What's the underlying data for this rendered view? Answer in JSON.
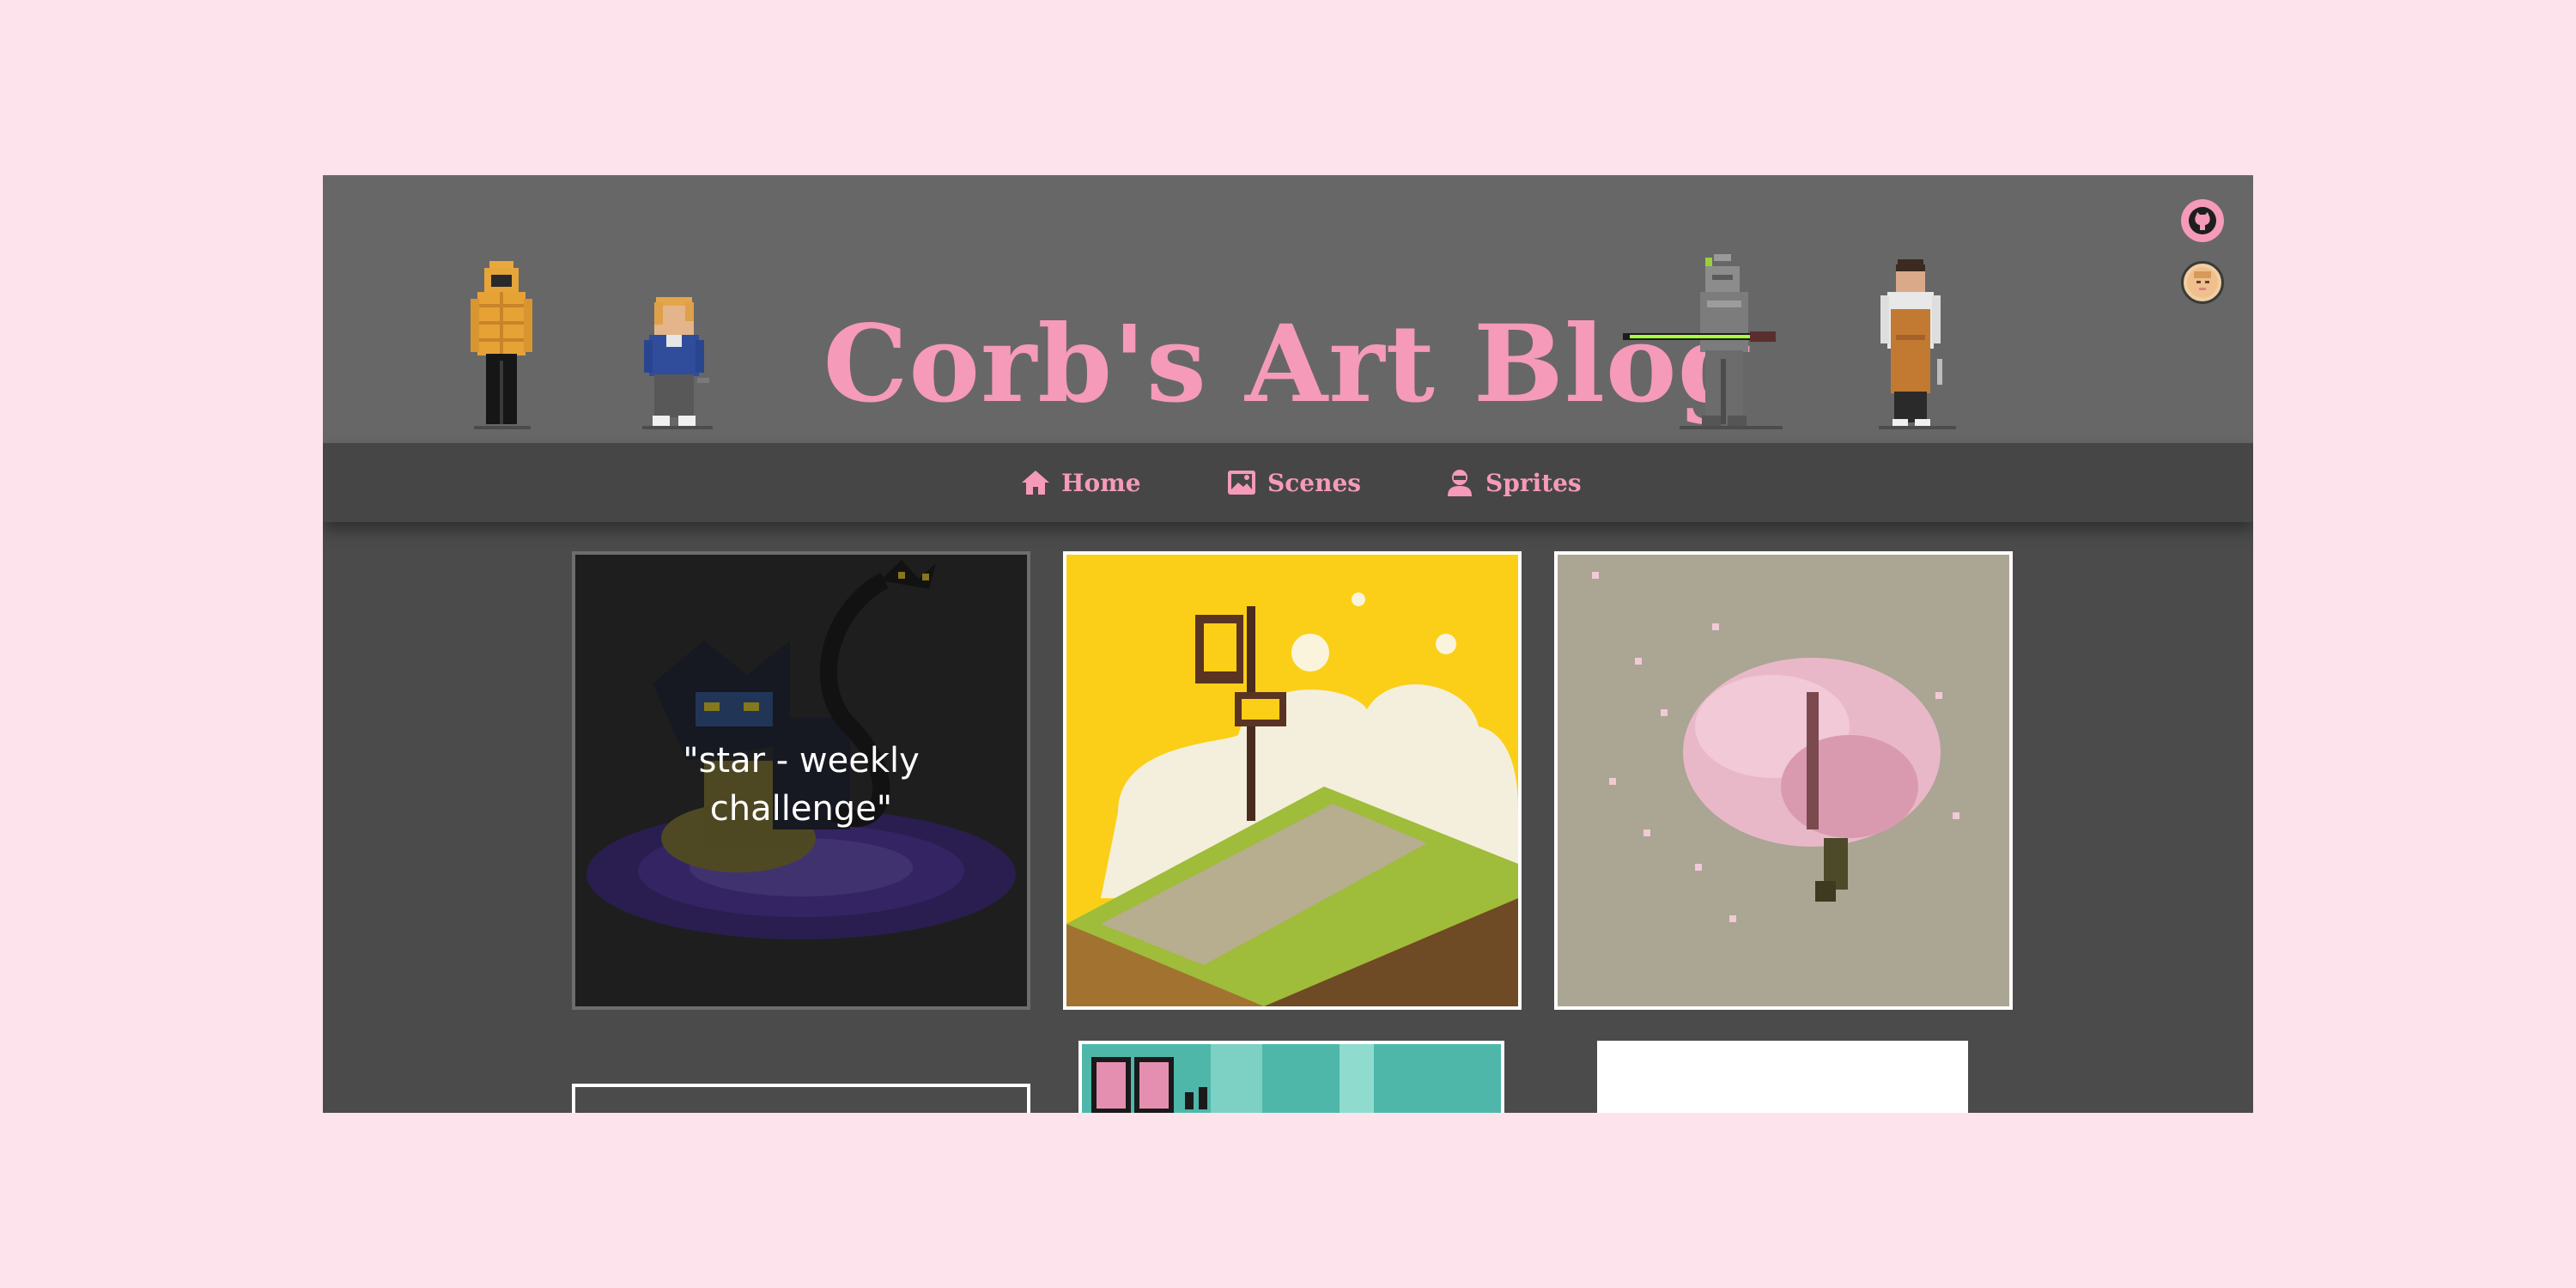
{
  "site": {
    "title": "Corb's Art Blog"
  },
  "colors": {
    "background": "#fde4ec",
    "accent": "#f59ab9",
    "header_bg": "#676767",
    "nav_bg": "#464646",
    "content_bg": "#4b4b4b"
  },
  "side_icons": [
    {
      "name": "github-icon"
    },
    {
      "name": "avatar-icon"
    }
  ],
  "nav": {
    "items": [
      {
        "label": "Home",
        "icon": "home-icon"
      },
      {
        "label": "Scenes",
        "icon": "image-icon"
      },
      {
        "label": "Sprites",
        "icon": "person-icon"
      }
    ]
  },
  "gallery": {
    "cards": [
      {
        "caption": "\"star - weekly challenge\"",
        "description": "dark electric creature on purple rug"
      },
      {
        "caption": "",
        "description": "isometric grass tile with flag on yellow"
      },
      {
        "caption": "",
        "description": "pink cherry blossom tree on taupe"
      }
    ]
  }
}
